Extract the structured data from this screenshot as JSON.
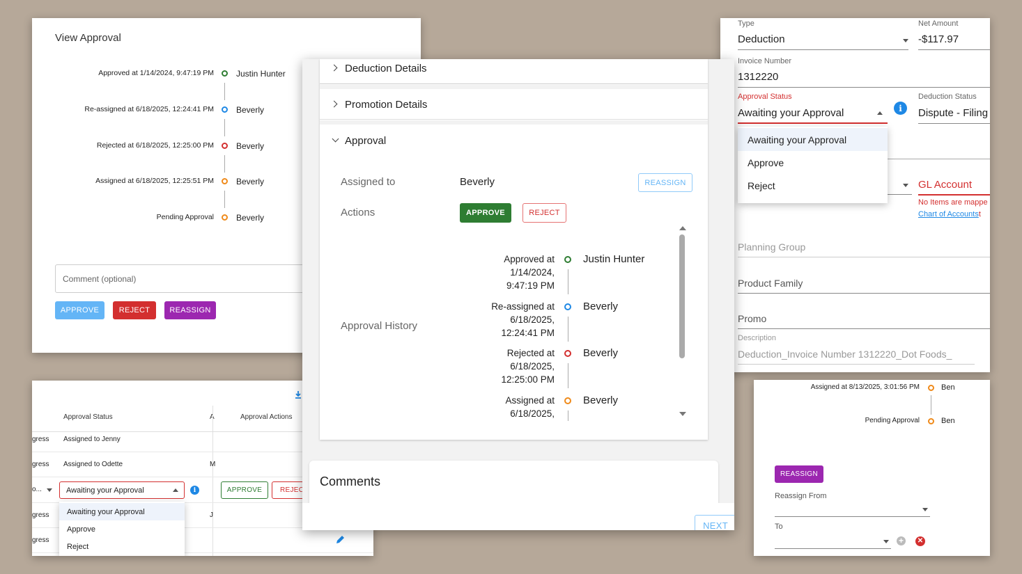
{
  "colors": {
    "green": "#2e7d32",
    "blue": "#1e88e5",
    "red": "#d32f2f",
    "orange": "#ef8a1a",
    "purple": "#9c27b0",
    "light_blue": "#64b5f6"
  },
  "panel_view": {
    "title": "View Approval",
    "history": [
      {
        "status": "Approved at 1/14/2024, 9:47:19 PM",
        "user": "Justin Hunter",
        "color": "green"
      },
      {
        "status": "Re-assigned at 6/18/2025, 12:24:41 PM",
        "user": "Beverly",
        "color": "blue"
      },
      {
        "status": "Rejected at 6/18/2025, 12:25:00 PM",
        "user": "Beverly",
        "color": "red"
      },
      {
        "status": "Assigned at 6/18/2025, 12:25:51 PM",
        "user": "Beverly",
        "color": "orange"
      },
      {
        "status": "Pending Approval",
        "user": "Beverly",
        "color": "orange"
      }
    ],
    "comment_placeholder": "Comment (optional)",
    "approve_label": "APPROVE",
    "reject_label": "REJECT",
    "reassign_label": "REASSIGN"
  },
  "panel_table": {
    "headers": {
      "approval_status": "Approval Status",
      "a": "A",
      "approval_actions": "Approval Actions"
    },
    "rows": [
      {
        "left": "gress",
        "status": "Assigned to Jenny",
        "a": ""
      },
      {
        "left": "gress",
        "status": "Assigned to Odette",
        "a": "M"
      },
      {
        "left": "o...",
        "status": "",
        "a": ""
      },
      {
        "left": "gress",
        "status": "",
        "a": "J"
      },
      {
        "left": "gress",
        "status": "",
        "a": ""
      }
    ],
    "select_value": "Awaiting your Approval",
    "approve_label": "APPROVE",
    "reject_label": "REJECT",
    "menu": [
      "Awaiting your Approval",
      "Approve",
      "Reject"
    ]
  },
  "panel_center": {
    "sections": {
      "deduction": "Deduction Details",
      "promotion": "Promotion Details",
      "approval": "Approval"
    },
    "assigned_to_label": "Assigned to",
    "assigned_to_value": "Beverly",
    "reassign_label": "REASSIGN",
    "actions_label": "Actions",
    "approve_label": "APPROVE",
    "reject_label": "REJECT",
    "history_label": "Approval History",
    "history": [
      {
        "l1": "Approved at",
        "l2": "1/14/2024,",
        "l3": "9:47:19 PM",
        "user": "Justin Hunter",
        "color": "green"
      },
      {
        "l1": "Re-assigned at",
        "l2": "6/18/2025,",
        "l3": "12:24:41 PM",
        "user": "Beverly",
        "color": "blue"
      },
      {
        "l1": "Rejected at",
        "l2": "6/18/2025,",
        "l3": "12:25:00 PM",
        "user": "Beverly",
        "color": "red"
      },
      {
        "l1": "Assigned at",
        "l2": "6/18/2025,",
        "l3": "",
        "user": "Beverly",
        "color": "orange"
      }
    ],
    "comments_title": "Comments",
    "next_label": "NEXT"
  },
  "panel_form": {
    "type_label": "Type",
    "type_value": "Deduction",
    "net_amount_label": "Net Amount",
    "net_amount_value": "-$117.97",
    "invoice_label": "Invoice Number",
    "invoice_value": "1312220",
    "approval_status_label": "Approval Status",
    "approval_status_value": "Awaiting your Approval",
    "deduction_status_label": "Deduction Status",
    "deduction_status_value": "Dispute - Filing",
    "menu": [
      "Awaiting your Approval",
      "Approve",
      "Reject"
    ],
    "gl_account_label": "GL Account",
    "no_items_text": "No Items are mappe",
    "chart_link": "Chart of Accounts",
    "chart_link_suffix": "t",
    "planning_group": "Planning Group",
    "product_family": "Product Family",
    "promo": "Promo",
    "description_label": "Description",
    "description_value": "Deduction_Invoice Number 1312220_Dot Foods_"
  },
  "panel_reassign": {
    "history": [
      {
        "status": "Assigned at 8/13/2025, 3:01:56 PM",
        "user": "Ben",
        "color": "orange"
      },
      {
        "status": "Pending Approval",
        "user": "Ben",
        "color": "orange"
      }
    ],
    "reassign_label": "REASSIGN",
    "from_label": "Reassign From",
    "to_label": "To"
  }
}
